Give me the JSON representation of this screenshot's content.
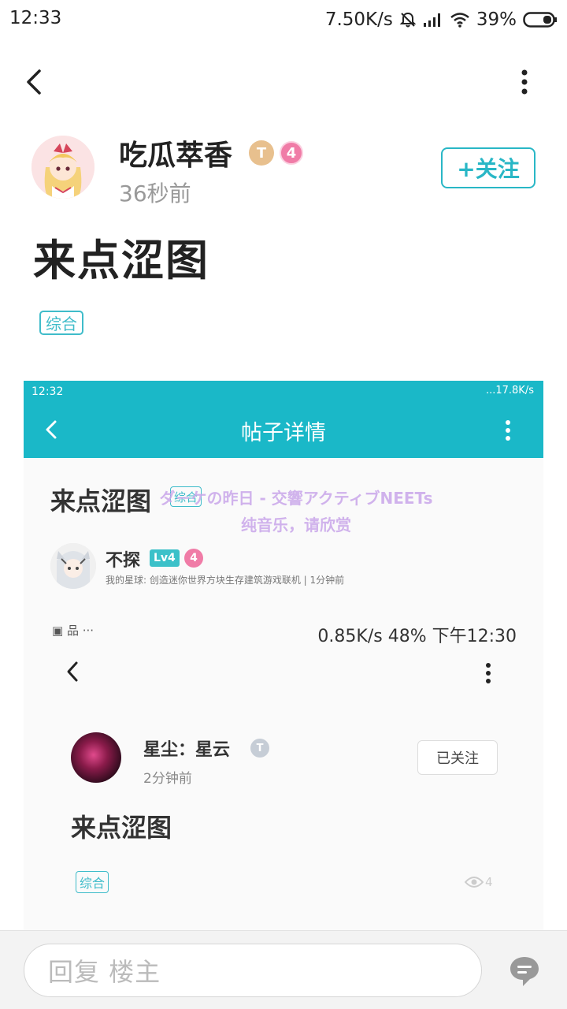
{
  "status_bar": {
    "time": "12:33",
    "net_speed": "7.50K/s",
    "battery": "39%"
  },
  "header": {
    "back_icon": "back-arrow-icon",
    "more_icon": "more-vertical-icon"
  },
  "author": {
    "name": "吃瓜萃香",
    "badge_letter": "T",
    "level": "4",
    "time": "36秒前",
    "follow_label": "+关注"
  },
  "post": {
    "title": "来点涩图",
    "tag": "综合"
  },
  "embedded": {
    "status_time": "12:32",
    "status_right": "...17.8K/s",
    "nav_title": "帖子详情",
    "title": "来点涩图",
    "tag": "综合",
    "music_line1": "ダ－ケの昨日 - 交響アクティブNEETs",
    "music_line2": "纯音乐，请欣赏",
    "user_name": "不探",
    "user_lv": "Lv4",
    "user_level": "4",
    "user_sub": "我的星球: 创造迷你世界方块生存建筑游戏联机 | 1分钟前",
    "inner_left": "▣ 品 ···",
    "inner_right": "0.85K/s 48% 下午12:30",
    "inner_author": "星尘：星云",
    "inner_time": "2分钟前",
    "inner_follow": "已关注",
    "inner_title": "来点涩图",
    "inner_tag": "综合",
    "inner_views": "4"
  },
  "reply_bar": {
    "placeholder": "回复 楼主",
    "chat_icon": "comment-bubble-icon"
  },
  "colors": {
    "accent": "#29b7c6",
    "level_pink": "#f07ca7",
    "embedded_bar": "#1ab8c8"
  }
}
